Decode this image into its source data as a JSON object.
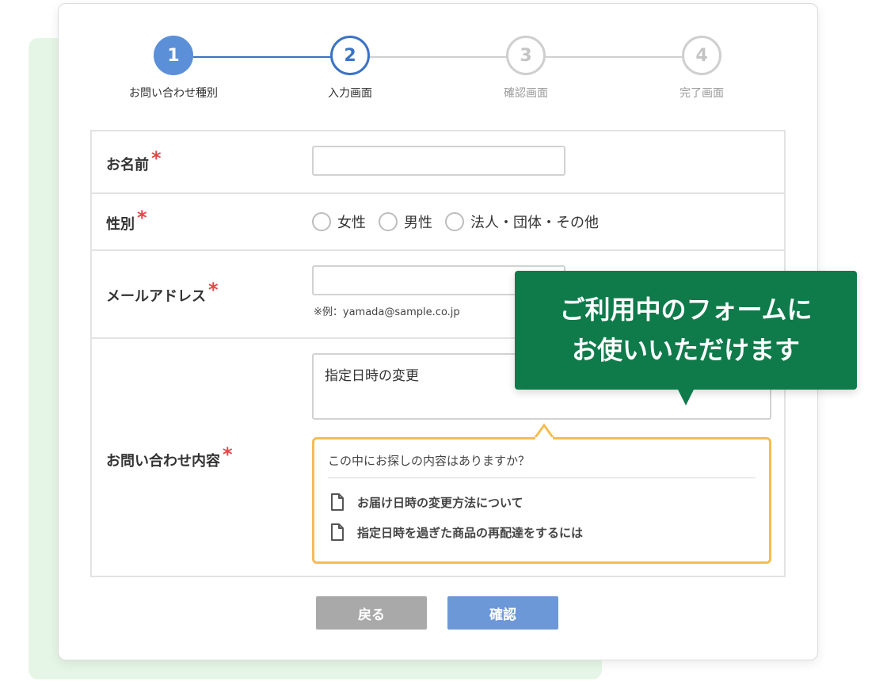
{
  "stepper": {
    "steps": [
      {
        "number": "1",
        "label": "お問い合わせ種別"
      },
      {
        "number": "2",
        "label": "入力画面"
      },
      {
        "number": "3",
        "label": "確認画面"
      },
      {
        "number": "4",
        "label": "完了画面"
      }
    ],
    "current_step": 2
  },
  "form": {
    "name": {
      "label": "お名前",
      "required_mark": "*",
      "value": ""
    },
    "gender": {
      "label": "性別",
      "required_mark": "*",
      "options": [
        "女性",
        "男性",
        "法人・団体・その他"
      ]
    },
    "email": {
      "label": "メールアドレス",
      "required_mark": "*",
      "value": "",
      "hint": "※例：yamada@sample.co.jp"
    },
    "inquiry": {
      "label": "お問い合わせ内容",
      "required_mark": "*",
      "value": "指定日時の変更",
      "suggestions": {
        "title": "この中にお探しの内容はありますか？",
        "items": [
          "お届け日時の変更方法について",
          "指定日時を過ぎた商品の再配達をするには"
        ]
      }
    }
  },
  "buttons": {
    "back": "戻る",
    "confirm": "確認"
  },
  "tooltip": {
    "line1": "ご利用中のフォームに",
    "line2": "お使いいただけます"
  },
  "colors": {
    "step_done": "#5b8fd8",
    "step_current": "#3b73c4",
    "required": "#e04848",
    "suggest_border": "#f4bd52",
    "tooltip_bg": "#0f7a4a",
    "confirm_button": "#6c98d7",
    "back_button": "#a9a9a9"
  }
}
